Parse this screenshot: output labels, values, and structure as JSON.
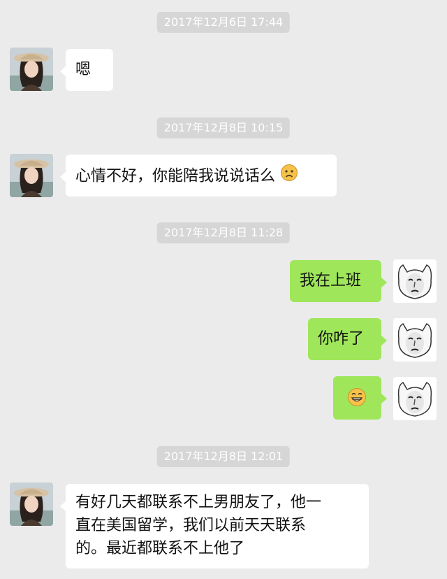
{
  "timestamps": [
    "2017年12月6日 17:44",
    "2017年12月8日 10:15",
    "2017年12月8日 11:28",
    "2017年12月8日 12:01"
  ],
  "messages": {
    "m1": "嗯",
    "m2": "心情不好，你能陪我说说话么",
    "m3": "我在上班",
    "m4": "你咋了",
    "m6_line1": "有好几天都联系不上男朋友了，他一",
    "m6_line2": "直在美国留学，我们以前天天联系",
    "m6_line3": "的。最近都联系不上他了"
  },
  "icons": {
    "sad_face": "sad-face-emoji",
    "grin_face": "grinning-face-emoji",
    "contact_avatar": "contact-avatar",
    "self_avatar": "cat-sticker-avatar"
  },
  "colors": {
    "background": "#ebebeb",
    "bubble_received": "#ffffff",
    "bubble_sent": "#9fe65a",
    "timestamp_bg": "#d6d6d6"
  }
}
